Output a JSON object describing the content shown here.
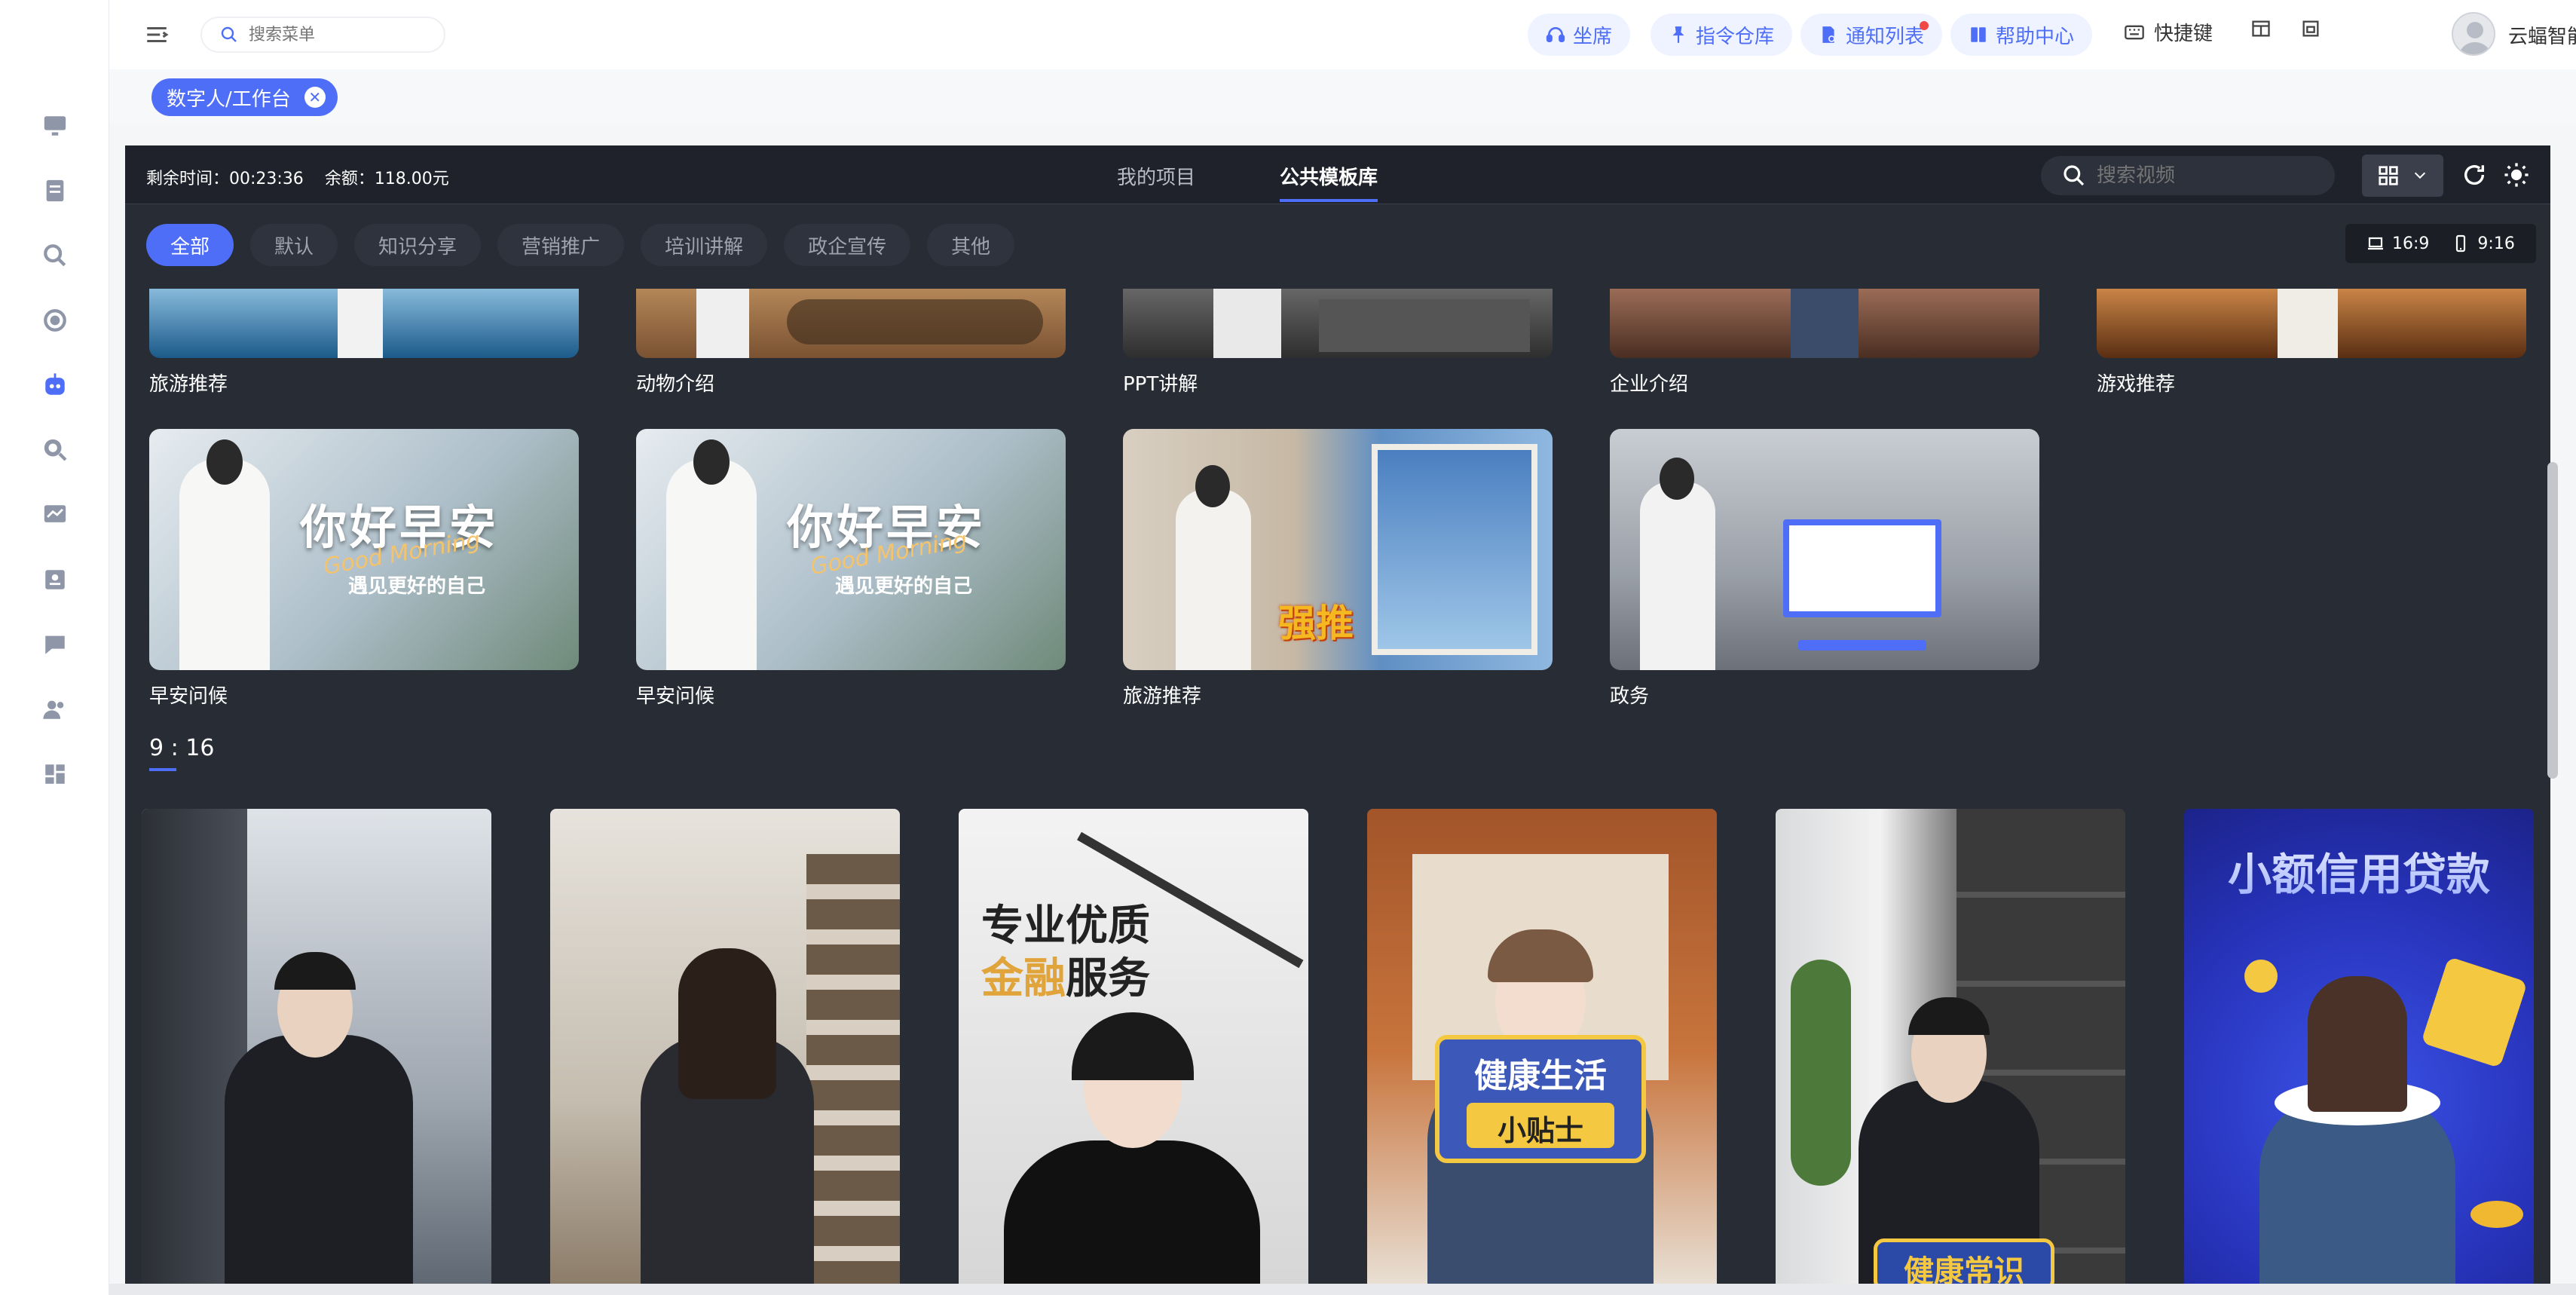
{
  "sidebar": {
    "icons": [
      "monitor-icon",
      "document-icon",
      "zoom-search-icon",
      "target-icon",
      "robot-icon",
      "search-doc-icon",
      "chart-icon",
      "id-card-icon",
      "chat-icon",
      "users-icon",
      "dashboard-icon"
    ],
    "active_index": 4
  },
  "topbar": {
    "search_placeholder": "搜索菜单",
    "pills": [
      {
        "label": "坐席",
        "icon": "headset-icon"
      },
      {
        "label": "指令仓库",
        "icon": "pin-icon"
      },
      {
        "label": "通知列表",
        "icon": "bell-doc-icon",
        "badge": true
      },
      {
        "label": "帮助中心",
        "icon": "book-icon"
      }
    ],
    "shortcut_label": "快捷键",
    "user_name": "云蝠智能自用"
  },
  "tagbar": {
    "tag_label": "数字人/工作台",
    "close_glyph": "✕"
  },
  "workspace": {
    "remaining_time": "剩余时间：00:23:36",
    "balance": "余额：118.00元",
    "tabs": [
      "我的项目",
      "公共模板库"
    ],
    "active_tab": 1,
    "search_placeholder": "搜索视频",
    "categories": [
      "全部",
      "默认",
      "知识分享",
      "营销推广",
      "培训讲解",
      "政企宣传",
      "其他"
    ],
    "active_category": 0,
    "ratio_options": [
      "16:9",
      "9:16"
    ]
  },
  "landscape_cards_row1": [
    {
      "label": "旅游推荐",
      "tint": "#1b5a8a",
      "tint2": "#8fc0e0"
    },
    {
      "label": "动物介绍",
      "tint": "#7a5232",
      "tint2": "#b88a5a"
    },
    {
      "label": "PPT讲解",
      "tint": "#4a4a4a",
      "tint2": "#9a9a9a"
    },
    {
      "label": "企业介绍",
      "tint": "#5a3a2a",
      "tint2": "#a0705a"
    },
    {
      "label": "游戏推荐",
      "tint": "#6a3a1a",
      "tint2": "#c07a3a"
    }
  ],
  "landscape_cards_row2": [
    {
      "label": "早安问候",
      "title": "你好早安",
      "script": "Good Morning",
      "sub": "遇见更好的自己",
      "style": "morning"
    },
    {
      "label": "早安问候",
      "title": "你好早安",
      "script": "Good Morning",
      "sub": "遇见更好的自己",
      "style": "morning"
    },
    {
      "label": "旅游推荐",
      "badge": "强推",
      "style": "travel"
    },
    {
      "label": "政务",
      "style": "office"
    }
  ],
  "portrait_section": {
    "title": "9 : 16",
    "cards": [
      {
        "style": "office-man",
        "text": ""
      },
      {
        "style": "library-woman",
        "text": ""
      },
      {
        "style": "finance",
        "text_line1": "专业优质",
        "text_line2_highlight": "金融",
        "text_line2_rest": "服务"
      },
      {
        "style": "health",
        "text_line1": "健康生活",
        "text_line2": "小贴士"
      },
      {
        "style": "knowledge",
        "text_line1": "健康常识"
      },
      {
        "style": "loan",
        "text_line1": "小额信用贷款"
      }
    ]
  }
}
